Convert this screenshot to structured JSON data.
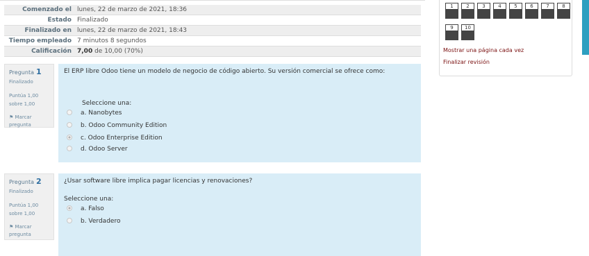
{
  "summary": [
    {
      "label": "Comenzado el",
      "value": "lunes, 22 de marzo de 2021, 18:36"
    },
    {
      "label": "Estado",
      "value": "Finalizado"
    },
    {
      "label": "Finalizado en",
      "value": "lunes, 22 de marzo de 2021, 18:43"
    },
    {
      "label": "Tiempo empleado",
      "value": "7 minutos 8 segundos"
    },
    {
      "label": "Calificación",
      "value_bold": "7,00",
      "value_rest": "de 10,00 (70%)"
    }
  ],
  "questions": [
    {
      "label": "Pregunta",
      "number": "1",
      "state": "Finalizado",
      "score_line1": "Puntúa 1,00",
      "score_line2": "sobre 1,00",
      "flag_line1": "Marcar",
      "flag_line2": "pregunta",
      "text": "El ERP libre Odoo tiene un modelo de negocio de código abierto. Su versión comercial se ofrece como:",
      "prompt": "Seleccione una:",
      "options": [
        "a. Nanobytes",
        "b. Odoo Community Edition",
        "c. Odoo Enterprise Edition",
        "d. Odoo Server"
      ],
      "selected": 2
    },
    {
      "label": "Pregunta",
      "number": "2",
      "state": "Finalizado",
      "score_line1": "Puntúa 1,00",
      "score_line2": "sobre 1,00",
      "flag_line1": "Marcar",
      "flag_line2": "pregunta",
      "text": "¿Usar software libre implica pagar licencias y renovaciones?",
      "prompt": "Seleccione una:",
      "options": [
        "a. Falso",
        "b. Verdadero"
      ],
      "selected": 0
    }
  ],
  "nav": {
    "buttons": [
      "1",
      "2",
      "3",
      "4",
      "5",
      "6",
      "7",
      "8",
      "9",
      "10"
    ],
    "show_one_page": "Mostrar una página cada vez",
    "finish_review": "Finalizar revisión"
  },
  "icons": {
    "flag": "flag-icon",
    "radio": "radio-icon"
  }
}
